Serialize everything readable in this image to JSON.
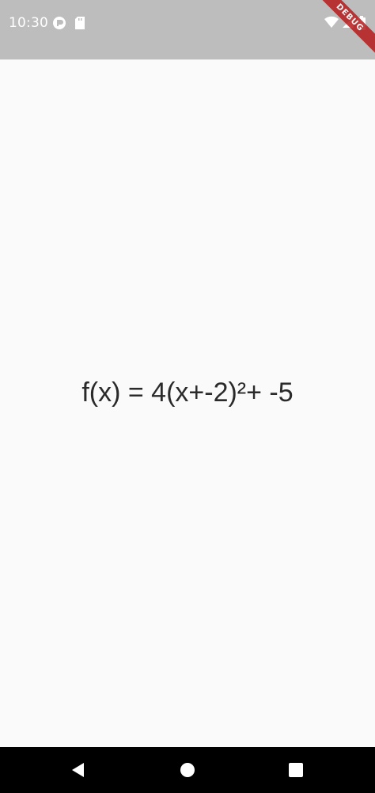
{
  "status_bar": {
    "time": "10:30",
    "icons": [
      "media-icon",
      "sd-card-icon",
      "wifi-icon",
      "signal-icon",
      "battery-icon"
    ]
  },
  "debug_banner": {
    "label": "DEBUG"
  },
  "main": {
    "formula": "f(x) = 4(x+-2)²+ -5"
  },
  "nav_bar": {
    "buttons": [
      "back-icon",
      "home-icon",
      "recents-icon"
    ]
  },
  "colors": {
    "status_bar": "#bdbdbd",
    "background": "#fafafa",
    "text": "#2a2a2a",
    "debug_ribbon": "#b71c1c",
    "nav_bar": "#000000"
  }
}
